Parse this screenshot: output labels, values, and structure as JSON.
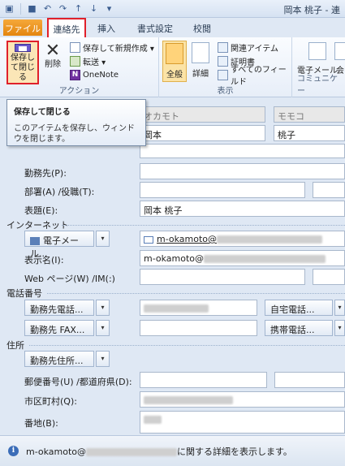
{
  "window": {
    "title": "岡本 桃子 - 連"
  },
  "tabs": {
    "file": "ファイル",
    "contact": "連絡先",
    "insert": "挿入",
    "format": "書式設定",
    "review": "校閲"
  },
  "ribbon": {
    "save_close": "保存して閉じる",
    "delete": "削除",
    "save_new": "保存して新規作成 ▾",
    "forward": "転送 ▾",
    "onenote": "OneNote",
    "group_actions": "アクション",
    "view_general": "全般",
    "view_details": "詳細",
    "related": "関連アイテム",
    "certificate": "証明書",
    "all_fields": "すべてのフィールド",
    "group_view": "表示",
    "email": "電子メール",
    "meeting": "会",
    "group_communicate": "コミュニケー"
  },
  "tooltip": {
    "title": "保存して閉じる",
    "body": "このアイテムを保存し、ウィンドウを閉じます。"
  },
  "form": {
    "furigana_last": "オカモト",
    "furigana_first": "モモコ",
    "last_name": "岡本",
    "first_name": "桃子",
    "company_label": "勤務先(P):",
    "department_label": "部署(A) /役職(T):",
    "file_as_label": "表題(E):",
    "file_as_value": "岡本 桃子",
    "section_internet": "インターネット",
    "email_button": "電子メール...",
    "email_value": "m-okamoto@",
    "display_name_label": "表示名(I):",
    "display_name_value": "m-okamoto@",
    "web_label": "Web ページ(W) /IM(:)",
    "section_phone": "電話番号",
    "business_phone": "勤務先電話...",
    "home_phone": "自宅電話...",
    "business_fax": "勤務先 FAX...",
    "mobile_phone": "携帯電話...",
    "section_address": "住所",
    "business_address": "勤務先住所...",
    "postal_label": "郵便番号(U) /都道府県(D):",
    "city_label": "市区町村(Q):",
    "street_label": "番地(B):"
  },
  "status": {
    "prefix": "m-okamoto@",
    "suffix": "に関する詳細を表示します。"
  }
}
